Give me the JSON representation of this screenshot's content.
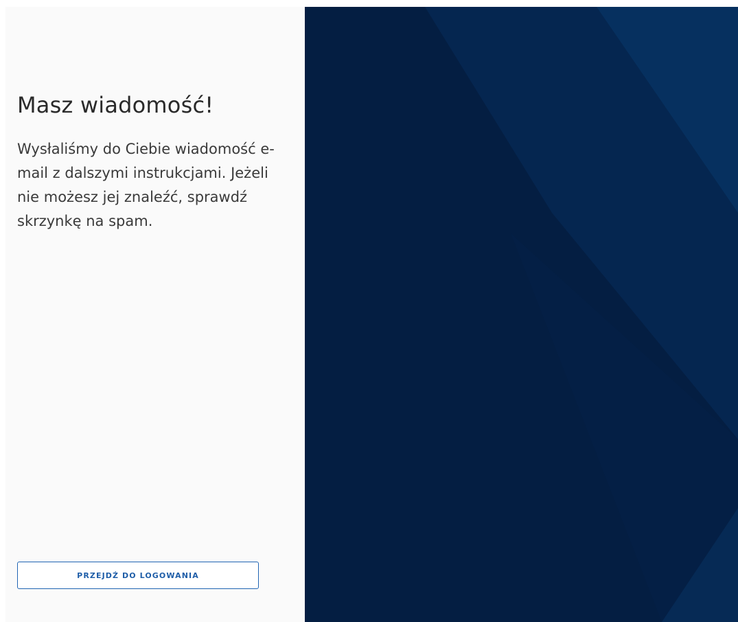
{
  "content": {
    "title": "Masz wiadomość!",
    "message": "Wysłaliśmy do Ciebie wiadomość e-mail z dalszymi instrukcjami. Jeżeli nie możesz jej znaleźć, sprawdź skrzynkę na spam.",
    "button_label": "PRZEJDŹ DO LOGOWANIA"
  },
  "colors": {
    "left_background": "#fafafa",
    "right_background": "#041e42",
    "accent": "#1f64b3",
    "facet_light": "#06305f",
    "facet_mid": "#052650"
  },
  "decoration": {
    "name": "geometric-background-pattern"
  }
}
